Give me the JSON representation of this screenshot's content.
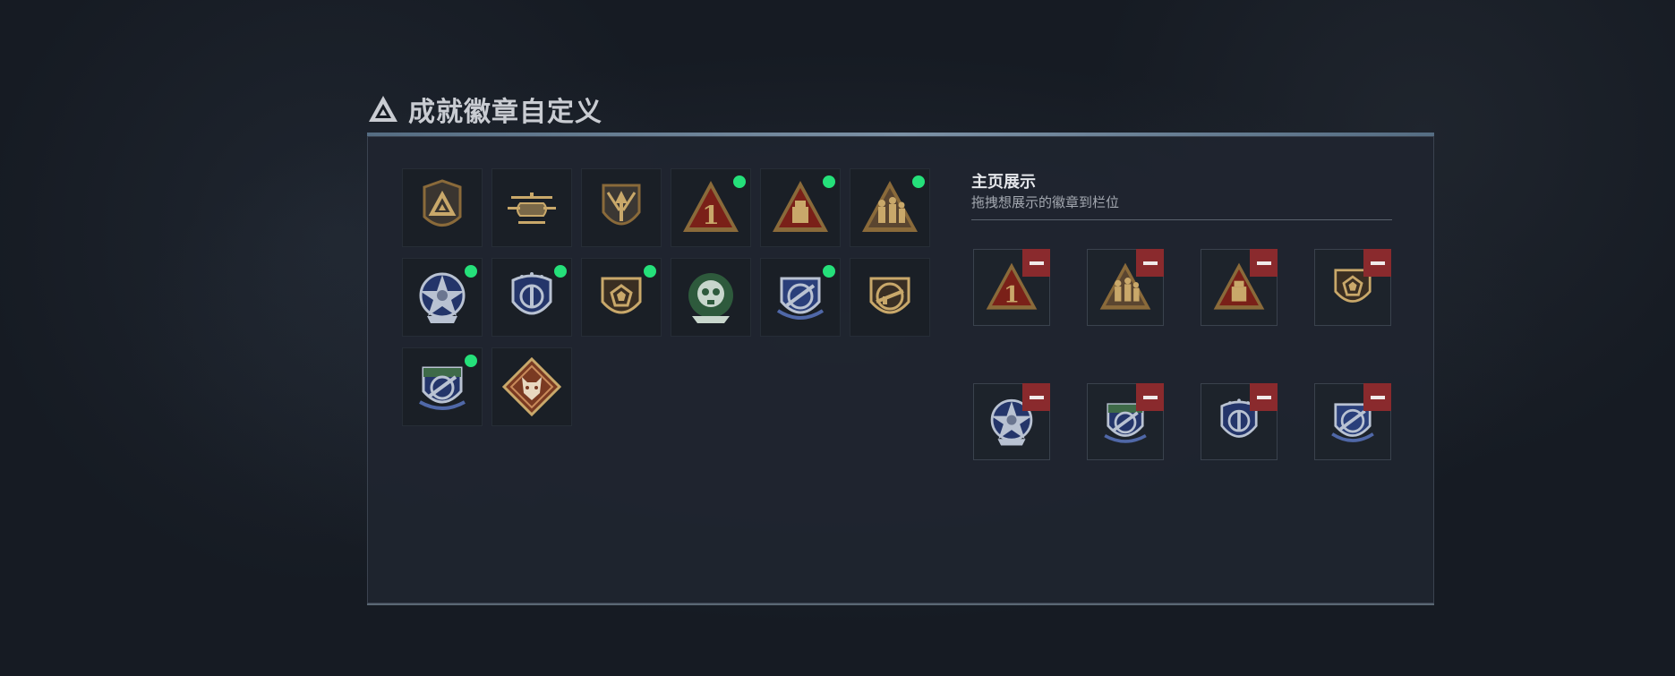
{
  "header": {
    "title": "成就徽章自定义",
    "icon": "triangle-emblem-icon"
  },
  "display_section": {
    "title": "主页展示",
    "subtitle": "拖拽想展示的徽章到栏位"
  },
  "colors": {
    "selected_dot": "#25e07a",
    "remove_button": "#8a2a2d",
    "panel_bg": "#1f252f"
  },
  "badges": [
    {
      "icon": "triangle-emblem-badge-icon",
      "selected": false
    },
    {
      "icon": "helicopter-badge-icon",
      "selected": false
    },
    {
      "icon": "arrow-shield-badge-icon",
      "selected": false
    },
    {
      "icon": "number-one-triangle-badge-icon",
      "selected": true
    },
    {
      "icon": "crate-triangle-badge-icon",
      "selected": true
    },
    {
      "icon": "soldiers-triangle-badge-icon",
      "selected": true
    },
    {
      "icon": "star-medal-badge-icon",
      "selected": true
    },
    {
      "icon": "police-shield-badge-icon",
      "selected": true
    },
    {
      "icon": "gem-shield-badge-icon",
      "selected": true
    },
    {
      "icon": "green-skull-badge-icon",
      "selected": false
    },
    {
      "icon": "jet-shield-blue-badge-icon",
      "selected": true
    },
    {
      "icon": "rifle-shield-badge-icon",
      "selected": false
    },
    {
      "icon": "jet-shield-green-badge-icon",
      "selected": true
    },
    {
      "icon": "wolf-diamond-badge-icon",
      "selected": false
    }
  ],
  "display_slots": [
    {
      "icon": "number-one-triangle-badge-icon"
    },
    {
      "icon": "soldiers-triangle-badge-icon"
    },
    {
      "icon": "crate-triangle-badge-icon"
    },
    {
      "icon": "gem-shield-badge-icon"
    },
    {
      "icon": "star-medal-badge-icon"
    },
    {
      "icon": "jet-shield-green-badge-icon"
    },
    {
      "icon": "police-shield-badge-icon"
    },
    {
      "icon": "jet-shield-blue-badge-icon"
    }
  ]
}
